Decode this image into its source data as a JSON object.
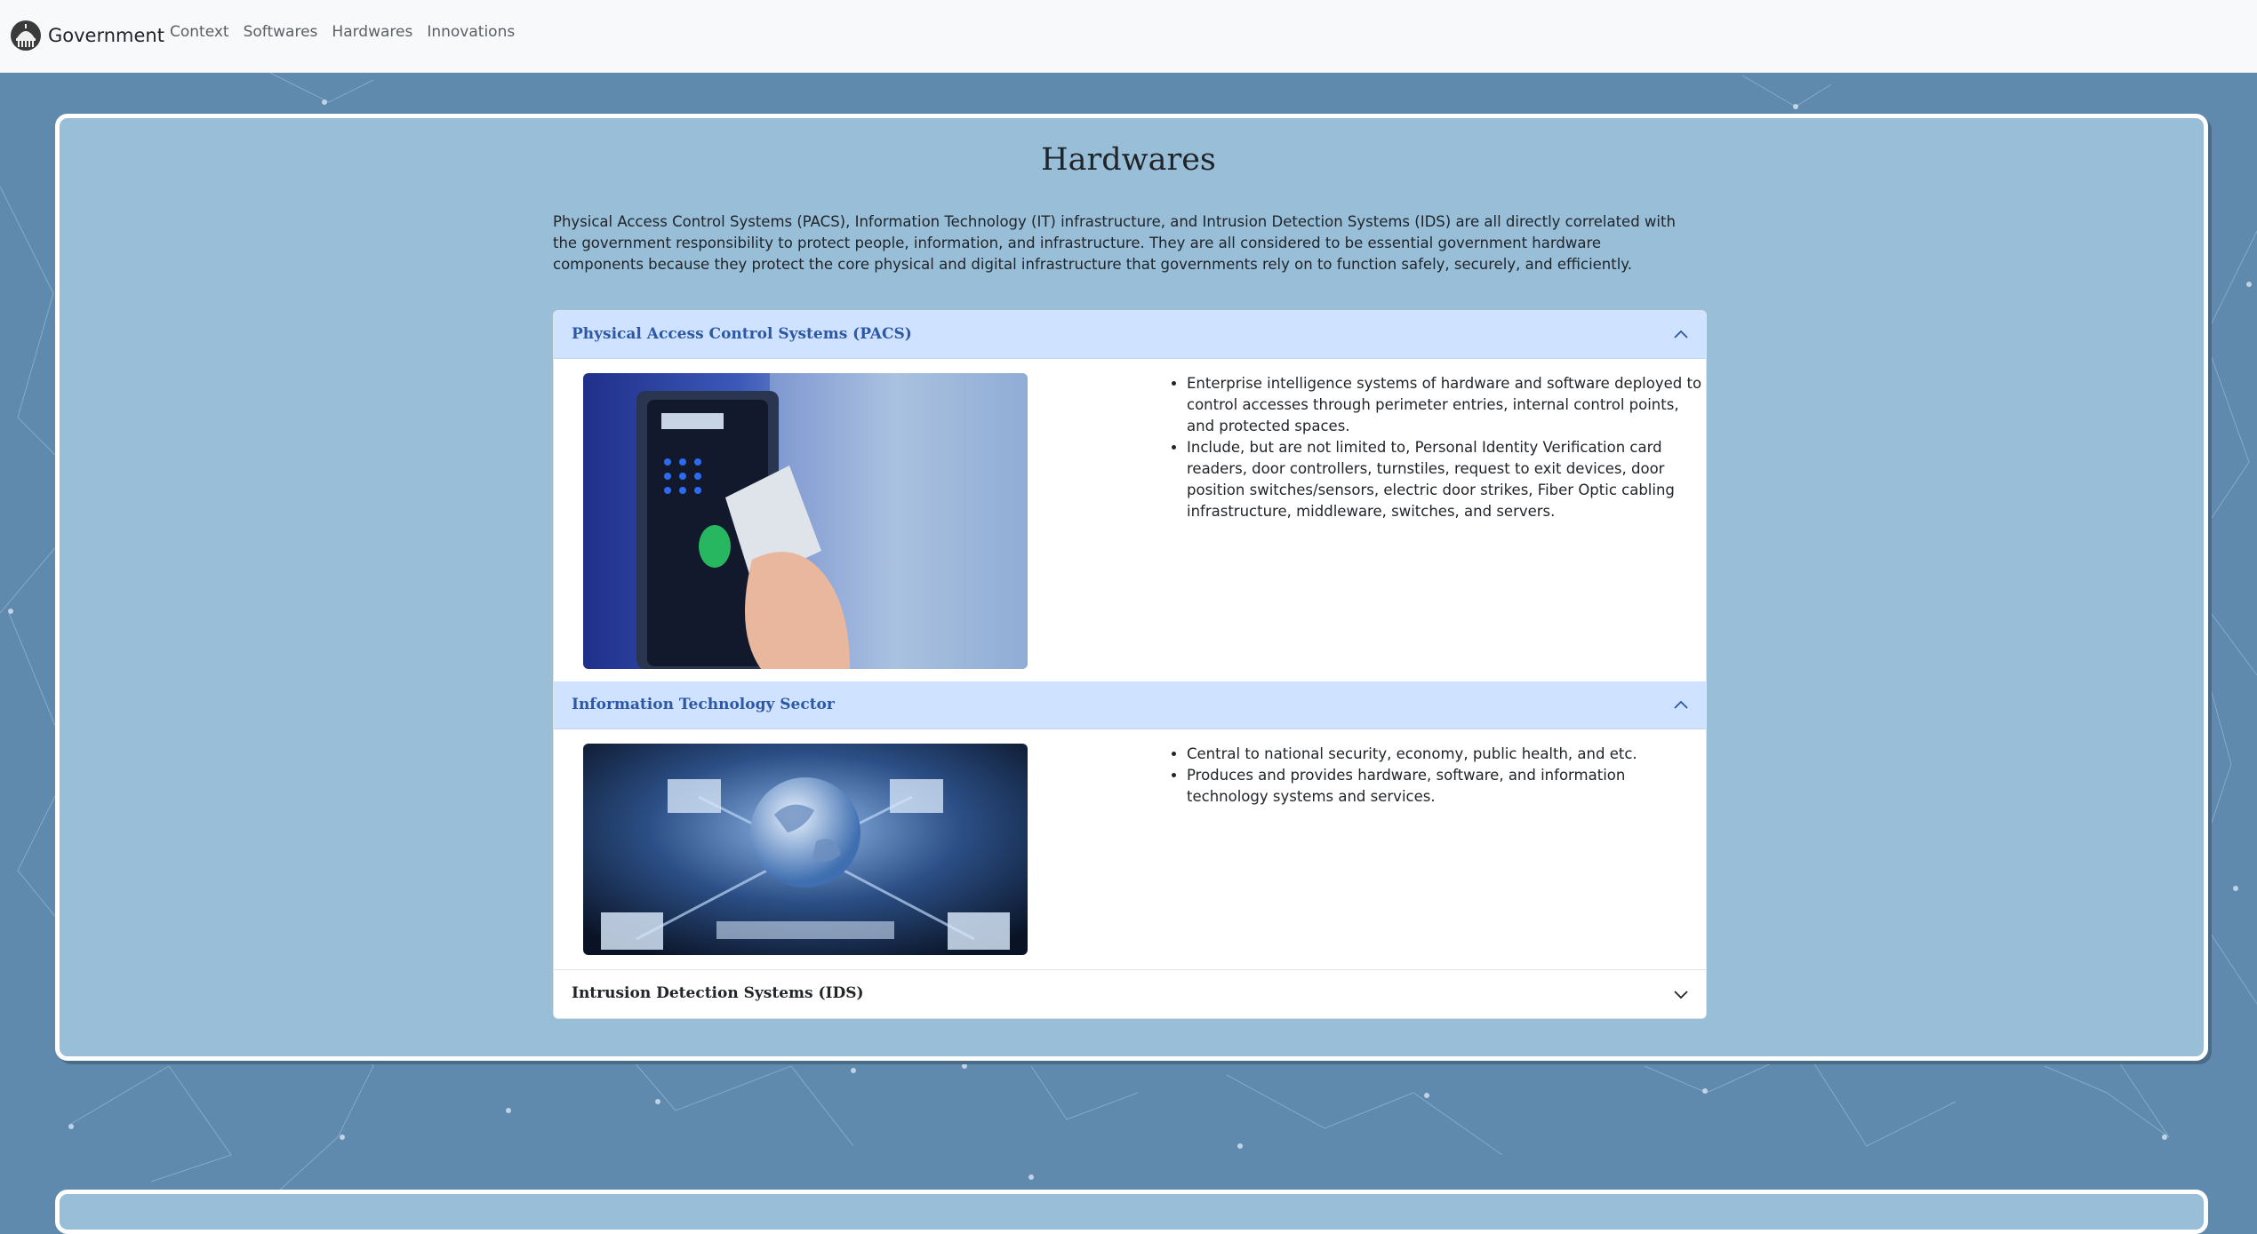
{
  "navbar": {
    "brand_name": "Government",
    "links": [
      "Context",
      "Softwares",
      "Hardwares",
      "Innovations"
    ]
  },
  "page": {
    "title": "Hardwares",
    "intro": "Physical Access Control Systems (PACS), Information Technology (IT) infrastructure, and Intrusion Detection Systems (IDS) are all directly correlated with the government responsibility to protect people, information, and infrastructure. They are all considered to be essential government hardware components because they protect the core physical and digital infrastructure that governments rely on to function safely, securely, and efficiently."
  },
  "accordion": {
    "sections": [
      {
        "title": "Physical Access Control Systems (PACS)",
        "expanded": true,
        "image_icon": "keycard-reader-photo",
        "bullets": [
          "Enterprise intelligence systems of hardware and software deployed to control accesses through perimeter entries, internal control points, and protected spaces.",
          "Include, but are not limited to, Personal Identity Verification card readers, door controllers, turnstiles, request to exit devices, door position switches/sensors, electric door strikes, Fiber Optic cabling infrastructure, middleware, switches, and servers."
        ]
      },
      {
        "title": "Information Technology Sector",
        "expanded": true,
        "image_icon": "globe-network-photo",
        "bullets": [
          "Central to national security, economy, public health, and etc.",
          "Produces and provides hardware, software, and information technology systems and services."
        ]
      },
      {
        "title": "Intrusion Detection Systems (IDS)",
        "expanded": false
      }
    ]
  },
  "colors": {
    "page_background": "#5f89ad",
    "card_background": "#98bed8",
    "accordion_active_header": "#cfe2ff",
    "accordion_active_text": "#2c58a7"
  }
}
